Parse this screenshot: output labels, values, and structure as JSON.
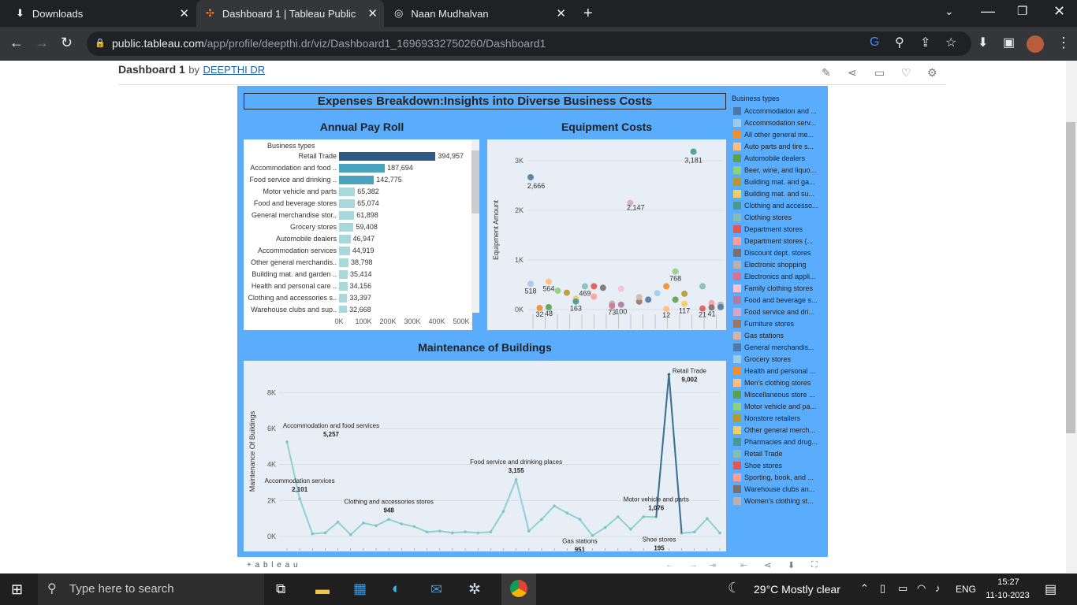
{
  "browser": {
    "tabs": [
      {
        "label": "Downloads",
        "icon": "download-icon"
      },
      {
        "label": "Dashboard 1 | Tableau Public",
        "icon": "tableau-icon"
      },
      {
        "label": "Naan Mudhalvan",
        "icon": "globe-icon"
      }
    ],
    "url_host": "public.tableau.com",
    "url_path": "/app/profile/deepthi.dr/viz/Dashboard1_16969332750260/Dashboard1"
  },
  "page": {
    "title": "Dashboard 1",
    "by": "by",
    "author": "DEEPTHI DR"
  },
  "dashboard": {
    "title": "Expenses Breakdown:Insights into Diverse Business Costs",
    "payroll_title": "Annual Pay Roll",
    "equipment_title": "Equipment Costs",
    "maintenance_title": "Maintenance of Buildings",
    "legend_title": "Business types",
    "footer_brand": "+ a b l e a u"
  },
  "chart_data": [
    {
      "type": "bar",
      "title": "Annual Pay Roll",
      "header": "Business types",
      "categories": [
        "Retail Trade",
        "Accommodation and food ..",
        "Food service and drinking ..",
        "Motor vehicle and parts",
        "Food and beverage stores",
        "General merchandise stor..",
        "Grocery stores",
        "Automobile dealers",
        "Accommodation services",
        "Other general merchandis..",
        "Building mat. and garden ..",
        "Health and personal care ..",
        "Clothing and accessories s..",
        "Warehouse clubs and sup.."
      ],
      "values": [
        394957,
        187694,
        142775,
        65382,
        65074,
        61898,
        59408,
        46947,
        44919,
        38798,
        35414,
        34156,
        33397,
        32668
      ],
      "labels": [
        "394,957",
        "187,694",
        "142,775",
        "65,382",
        "65,074",
        "61,898",
        "59,408",
        "46,947",
        "44,919",
        "38,798",
        "35,414",
        "34,156",
        "33,397",
        "32,668"
      ],
      "xticks": [
        "0K",
        "100K",
        "200K",
        "300K",
        "400K",
        "500K"
      ],
      "xlim": [
        0,
        500000
      ]
    },
    {
      "type": "scatter",
      "title": "Equipment Costs",
      "ylabel": "Equipment Amount",
      "yticks": [
        "0K",
        "1K",
        "2K",
        "3K"
      ],
      "ylim": [
        0,
        3300
      ],
      "points": [
        {
          "x": 1,
          "y": 2666,
          "label": "2,666"
        },
        {
          "x": 1,
          "y": 518,
          "label": "518"
        },
        {
          "x": 2,
          "y": 32,
          "label": "32"
        },
        {
          "x": 3,
          "y": 564,
          "label": "564"
        },
        {
          "x": 3,
          "y": 48,
          "label": "48"
        },
        {
          "x": 4,
          "y": 380
        },
        {
          "x": 5,
          "y": 340
        },
        {
          "x": 6,
          "y": 220
        },
        {
          "x": 6,
          "y": 163,
          "label": "163"
        },
        {
          "x": 7,
          "y": 469,
          "label": "469"
        },
        {
          "x": 8,
          "y": 470
        },
        {
          "x": 8,
          "y": 260
        },
        {
          "x": 9,
          "y": 440
        },
        {
          "x": 10,
          "y": 120
        },
        {
          "x": 10,
          "y": 73,
          "label": "73"
        },
        {
          "x": 11,
          "y": 420
        },
        {
          "x": 11,
          "y": 100,
          "label": "100"
        },
        {
          "x": 12,
          "y": 2147,
          "label": "2,147"
        },
        {
          "x": 13,
          "y": 160
        },
        {
          "x": 13,
          "y": 250
        },
        {
          "x": 14,
          "y": 200
        },
        {
          "x": 15,
          "y": 330
        },
        {
          "x": 16,
          "y": 470
        },
        {
          "x": 16,
          "y": 12,
          "label": "12"
        },
        {
          "x": 17,
          "y": 200
        },
        {
          "x": 17,
          "y": 768,
          "label": "768"
        },
        {
          "x": 18,
          "y": 320
        },
        {
          "x": 18,
          "y": 117,
          "label": "117"
        },
        {
          "x": 19,
          "y": 3181,
          "label": "3,181"
        },
        {
          "x": 20,
          "y": 470
        },
        {
          "x": 20,
          "y": 21,
          "label": "21"
        },
        {
          "x": 21,
          "y": 130
        },
        {
          "x": 21,
          "y": 41,
          "label": "41"
        },
        {
          "x": 22,
          "y": 100
        },
        {
          "x": 22,
          "y": 50
        }
      ]
    },
    {
      "type": "line",
      "title": "Maintenance of Buildings",
      "ylabel": "Maintenance Of Buildings",
      "yticks": [
        "0K",
        "2K",
        "4K",
        "6K",
        "8K"
      ],
      "ylim": [
        0,
        9500
      ],
      "values": [
        5257,
        2101,
        150,
        200,
        800,
        100,
        750,
        600,
        948,
        700,
        550,
        250,
        300,
        200,
        250,
        200,
        250,
        1400,
        3155,
        300,
        950,
        1700,
        1300,
        951,
        50,
        500,
        1100,
        400,
        1100,
        1076,
        9002,
        180,
        250,
        1000,
        195
      ],
      "annotations": [
        {
          "index": 0,
          "name": "Accommodation and food services",
          "value": "5,257"
        },
        {
          "index": 1,
          "name": "Accommodation services",
          "value": "2,101"
        },
        {
          "index": 8,
          "name": "Clothing and accessories stores",
          "value": "948"
        },
        {
          "index": 18,
          "name": "Food service and drinking places",
          "value": "3,155"
        },
        {
          "index": 23,
          "name": "Gas stations",
          "value": "951"
        },
        {
          "index": 29,
          "name": "Motor vehicle and parts",
          "value": "1,076"
        },
        {
          "index": 30,
          "name": "Retail Trade",
          "value": "9,002"
        },
        {
          "index": 34,
          "name": "Shoe stores",
          "value": "195"
        }
      ]
    }
  ],
  "legend": [
    {
      "label": "Accommodation and ...",
      "color": "#4e79a7"
    },
    {
      "label": "Accommodation serv...",
      "color": "#a0cbe8"
    },
    {
      "label": "All other general me...",
      "color": "#f28e2b"
    },
    {
      "label": "Auto parts and tire s...",
      "color": "#ffbe7d"
    },
    {
      "label": "Automobile dealers",
      "color": "#59a14f"
    },
    {
      "label": "Beer, wine, and liquo...",
      "color": "#8cd17d"
    },
    {
      "label": "Building mat. and ga...",
      "color": "#b6992d"
    },
    {
      "label": "Building mat. and su...",
      "color": "#f1ce63"
    },
    {
      "label": "Clothing and accesso...",
      "color": "#499894"
    },
    {
      "label": "Clothing stores",
      "color": "#86bcb6"
    },
    {
      "label": "Department stores",
      "color": "#e15759"
    },
    {
      "label": "Department stores (...",
      "color": "#ff9d9a"
    },
    {
      "label": "Discount dept. stores",
      "color": "#79706e"
    },
    {
      "label": "Electronic shopping",
      "color": "#bab0ac"
    },
    {
      "label": "Electronics and appli...",
      "color": "#d37295"
    },
    {
      "label": "Family clothing stores",
      "color": "#fabfd2"
    },
    {
      "label": "Food and beverage s...",
      "color": "#b07aa1"
    },
    {
      "label": "Food service and dri...",
      "color": "#d4a6c8"
    },
    {
      "label": "Furniture stores",
      "color": "#9d7660"
    },
    {
      "label": "Gas stations",
      "color": "#d7b5a6"
    },
    {
      "label": "General merchandis...",
      "color": "#4e79a7"
    },
    {
      "label": "Grocery stores",
      "color": "#a0cbe8"
    },
    {
      "label": "Health and personal ...",
      "color": "#f28e2b"
    },
    {
      "label": "Men's clothing stores",
      "color": "#ffbe7d"
    },
    {
      "label": "Miscellaneous store ...",
      "color": "#59a14f"
    },
    {
      "label": "Motor vehicle and pa...",
      "color": "#8cd17d"
    },
    {
      "label": "Nonstore retailers",
      "color": "#b6992d"
    },
    {
      "label": "Other general merch...",
      "color": "#f1ce63"
    },
    {
      "label": "Pharmacies and drug...",
      "color": "#499894"
    },
    {
      "label": "Retail Trade",
      "color": "#86bcb6"
    },
    {
      "label": "Shoe stores",
      "color": "#e15759"
    },
    {
      "label": "Sporting, book, and ...",
      "color": "#ff9d9a"
    },
    {
      "label": "Warehouse clubs an...",
      "color": "#79706e"
    },
    {
      "label": "Women's clothing st...",
      "color": "#bab0ac"
    }
  ],
  "taskbar": {
    "search_placeholder": "Type here to search",
    "weather": "29°C  Mostly clear",
    "lang": "ENG",
    "time": "15:27",
    "date": "11-10-2023"
  }
}
